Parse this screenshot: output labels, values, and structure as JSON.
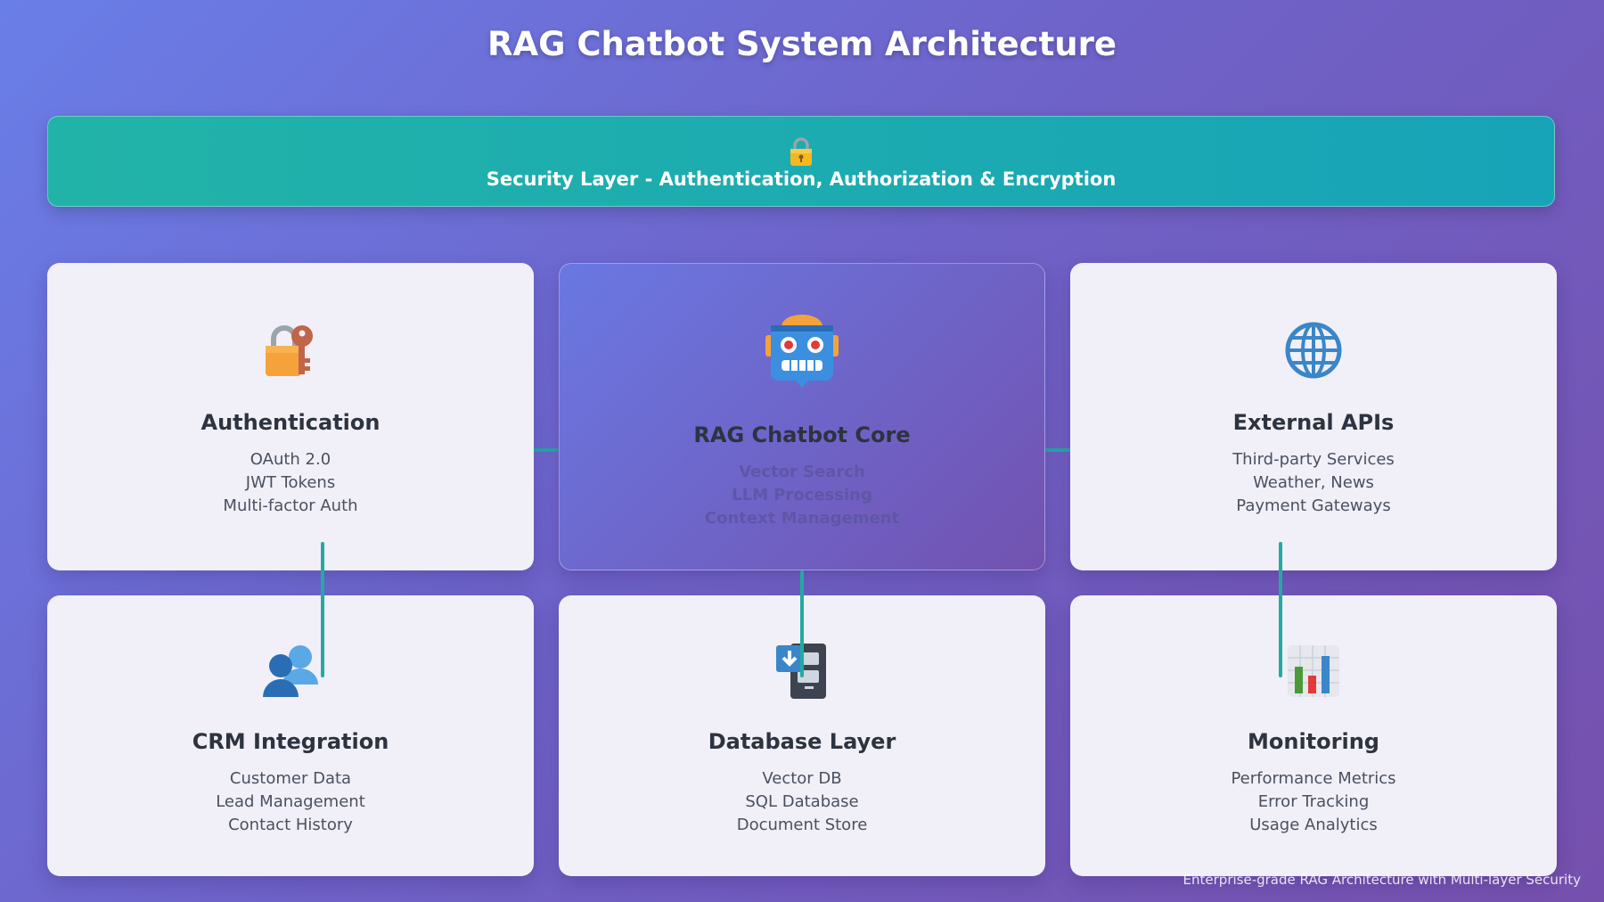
{
  "title": "RAG Chatbot System Architecture",
  "security_layer": {
    "label": "Security Layer - Authentication, Authorization & Encryption",
    "icon": "lock-icon"
  },
  "cards": {
    "authentication": {
      "title": "Authentication",
      "icon": "lock-with-key-icon",
      "items": [
        "OAuth 2.0",
        "JWT Tokens",
        "Multi-factor Auth"
      ]
    },
    "core": {
      "title": "RAG Chatbot Core",
      "icon": "robot-icon",
      "items": [
        "Vector Search",
        "LLM Processing",
        "Context Management"
      ]
    },
    "external_apis": {
      "title": "External APIs",
      "icon": "globe-icon",
      "items": [
        "Third-party Services",
        "Weather, News",
        "Payment Gateways"
      ]
    },
    "crm": {
      "title": "CRM Integration",
      "icon": "users-icon",
      "items": [
        "Customer Data",
        "Lead Management",
        "Contact History"
      ]
    },
    "database": {
      "title": "Database Layer",
      "icon": "file-cabinet-icon",
      "items": [
        "Vector DB",
        "SQL Database",
        "Document Store"
      ]
    },
    "monitoring": {
      "title": "Monitoring",
      "icon": "bar-chart-icon",
      "items": [
        "Performance Metrics",
        "Error Tracking",
        "Usage Analytics"
      ]
    }
  },
  "colors": {
    "connector": "#23a9a4",
    "security_bar": "#1aa9b3",
    "card_background": "#f1f0f8"
  },
  "footer": "Enterprise-grade RAG Architecture with Multi-layer Security"
}
